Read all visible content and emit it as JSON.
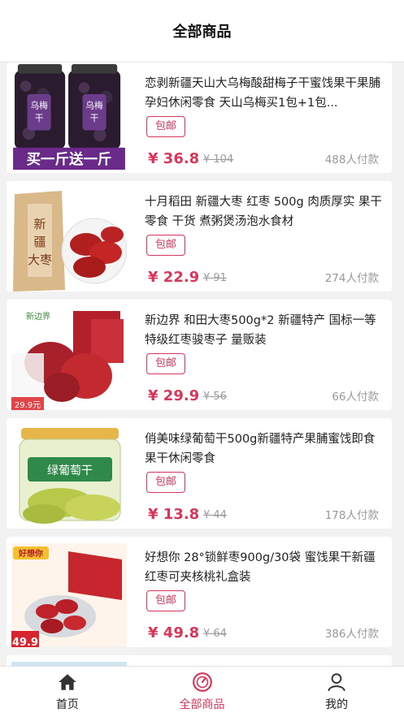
{
  "header": {
    "title": "全部商品"
  },
  "products": [
    {
      "title": "恋剥新疆天山大乌梅酸甜梅子干蜜饯果干果脯孕妇休闲零食 天山乌梅买1包+1包...",
      "tag": "包邮",
      "price": "¥ 36.8",
      "old_price": "¥ 104",
      "sold": "488人付款",
      "image": {
        "kind": "jar-prunes",
        "jar_label": "乌梅干",
        "banner": "买一斤送一斤"
      }
    },
    {
      "title": "十月稻田 新疆大枣 红枣 500g 肉质厚实 果干零食 干货 煮粥煲汤泡水食材",
      "tag": "包邮",
      "price": "¥ 22.9",
      "old_price": "¥ 91",
      "sold": "274人付款",
      "image": {
        "kind": "dates-bag",
        "bag_text": "新疆大枣"
      }
    },
    {
      "title": "新边界 和田大枣500g*2 新疆特产 国标一等特级红枣骏枣子 量贩装",
      "tag": "包邮",
      "price": "¥ 29.9",
      "old_price": "¥ 56",
      "sold": "66人付款",
      "image": {
        "kind": "dates-pile",
        "logo": "新边界",
        "badge": "29.9元"
      }
    },
    {
      "title": "俏美味绿葡萄干500g新疆特产果脯蜜饯即食果干休闲零食",
      "tag": "包邮",
      "price": "¥ 13.8",
      "old_price": "¥ 44",
      "sold": "178人付款",
      "image": {
        "kind": "raisin-jar",
        "jar_label": "绿葡萄干"
      }
    },
    {
      "title": "好想你 28°锁鲜枣900g/30袋 蜜饯果干新疆红枣可夹核桃礼盒装",
      "tag": "包邮",
      "price": "¥ 49.8",
      "old_price": "¥ 64",
      "sold": "386人付款",
      "image": {
        "kind": "gift-box",
        "brand": "好想你",
        "price_badge": "49.9"
      }
    }
  ],
  "tabbar": {
    "items": [
      {
        "label": "首页",
        "icon": "home-icon",
        "active": false
      },
      {
        "label": "全部商品",
        "icon": "compass-icon",
        "active": true
      },
      {
        "label": "我的",
        "icon": "user-icon",
        "active": false
      }
    ]
  },
  "colors": {
    "accent": "#d8365a",
    "muted": "#999999",
    "background": "#f2f2f2"
  }
}
